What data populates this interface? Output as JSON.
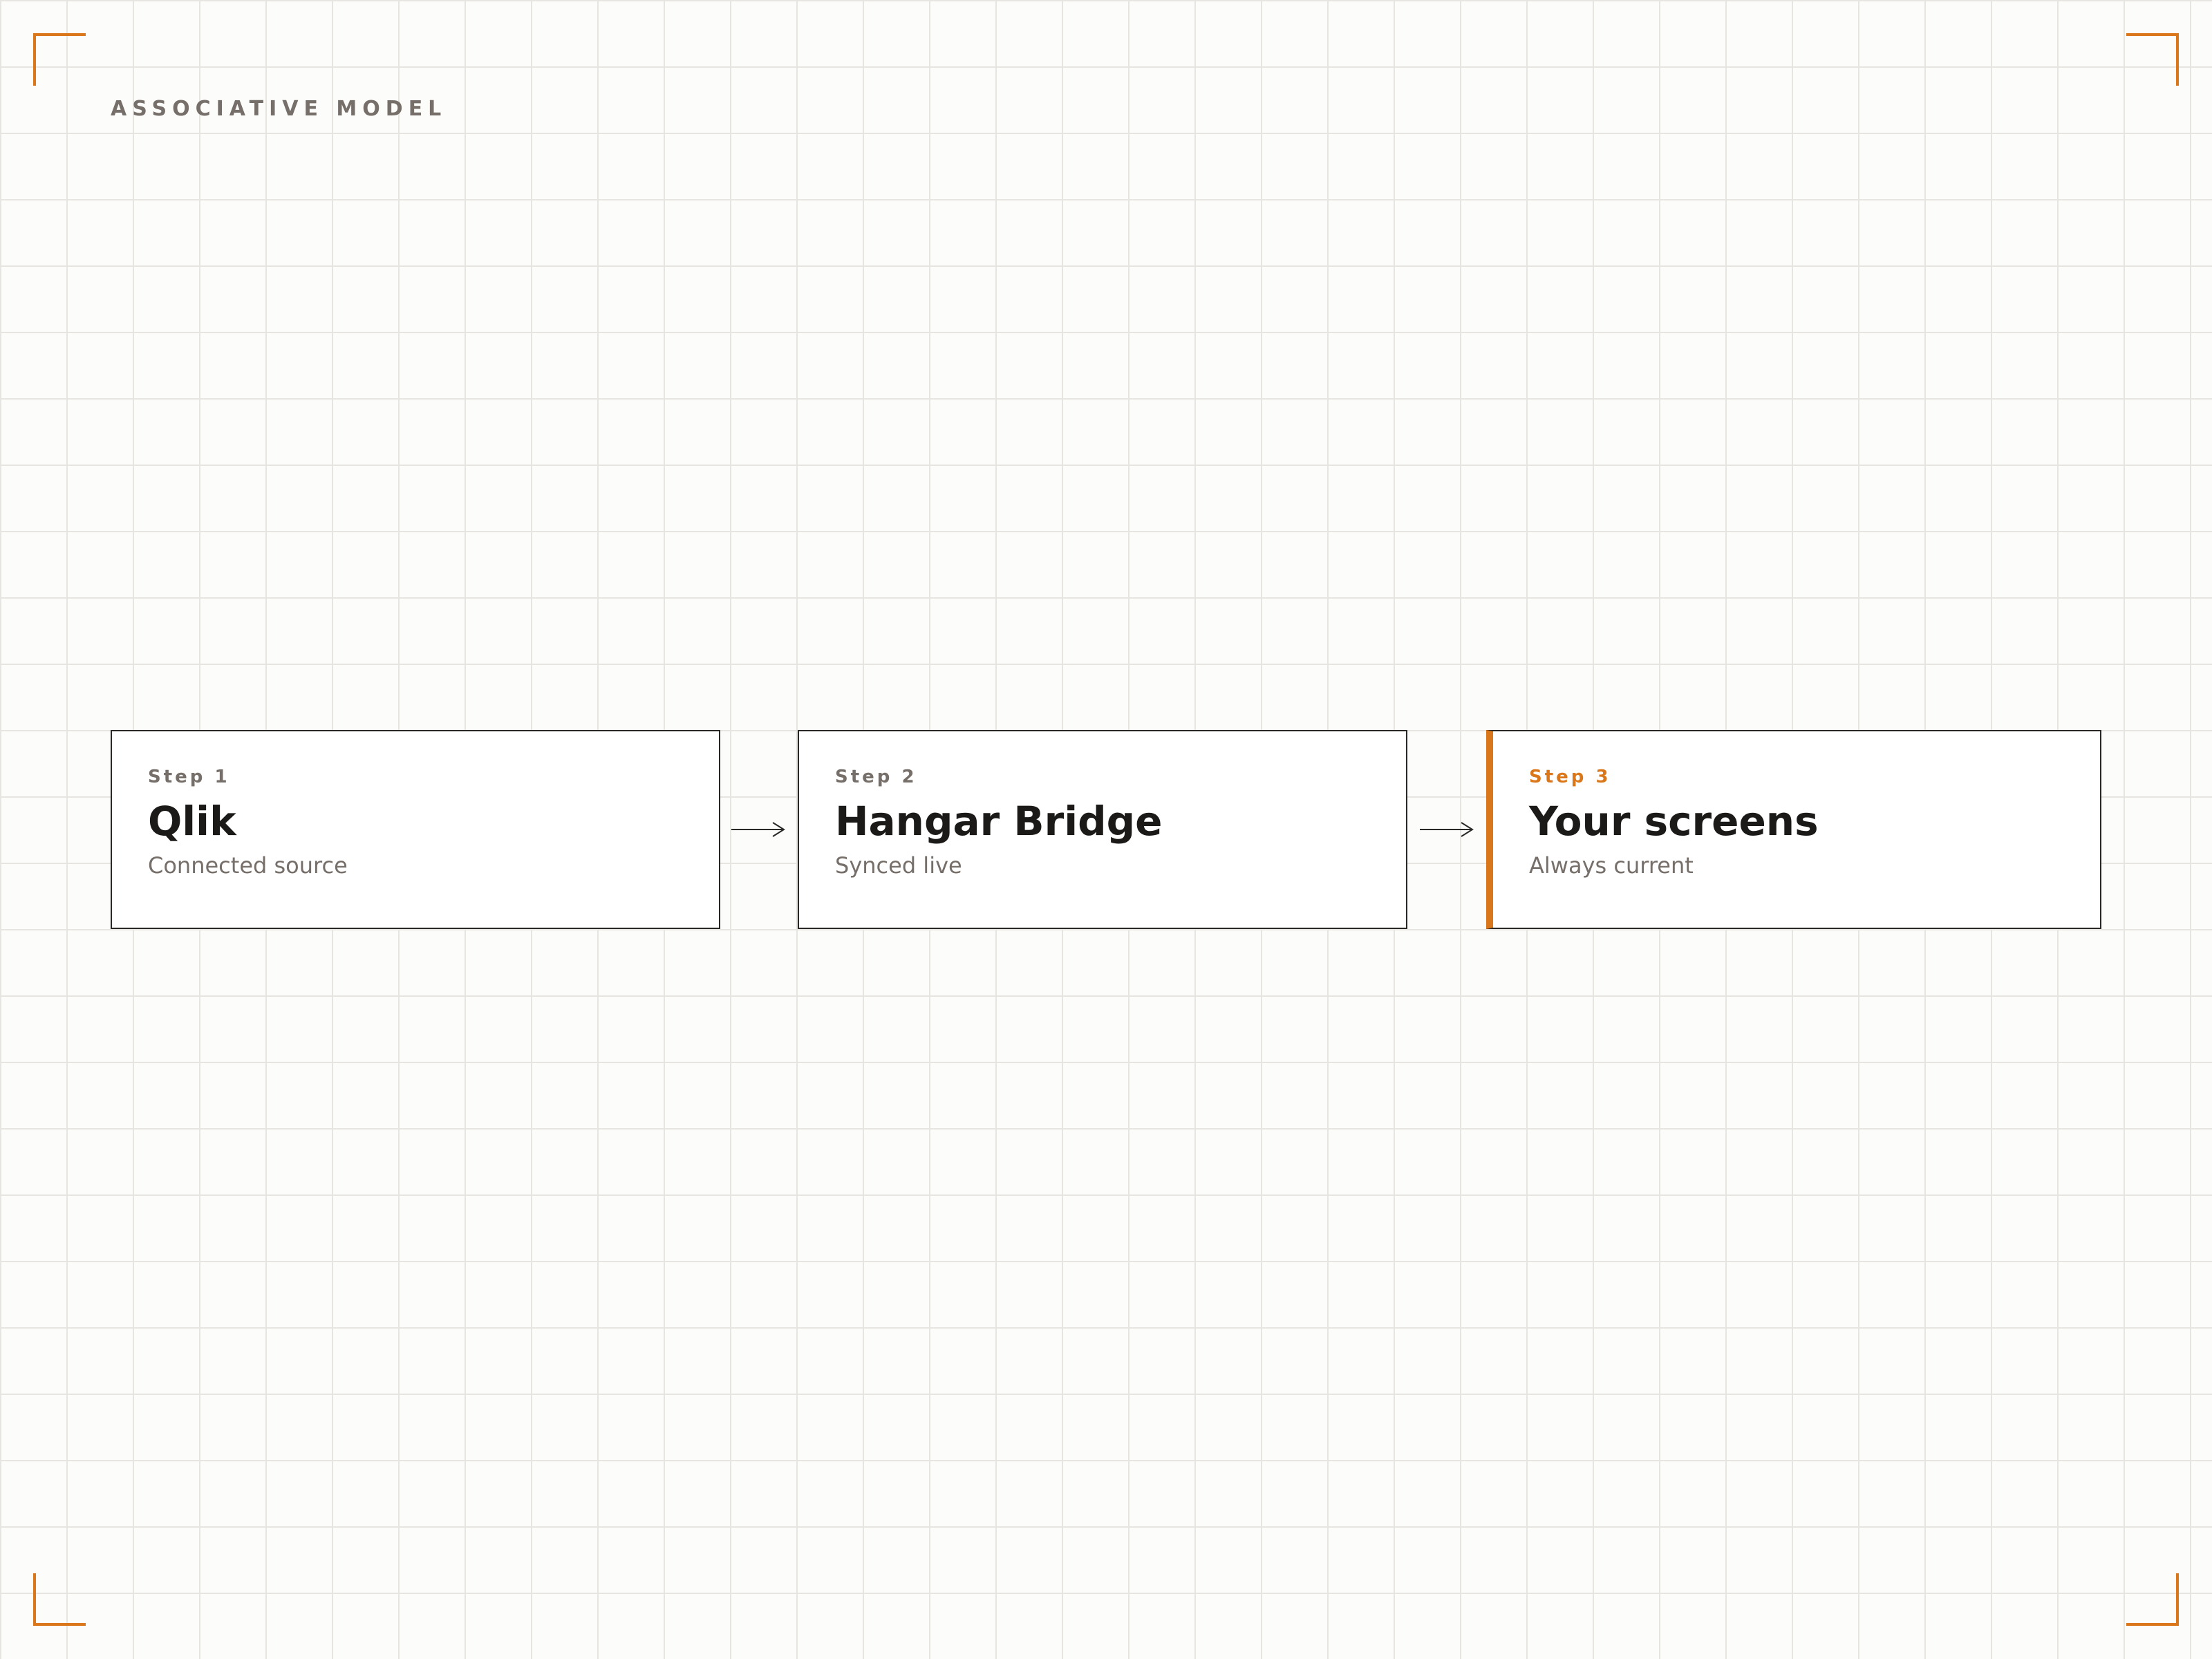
{
  "header": {
    "eyebrow": "ASSOCIATIVE MODEL"
  },
  "flow": {
    "accent_color": "#d9771a",
    "steps": [
      {
        "label": "Step 1",
        "title": "Qlik",
        "subtitle": "Connected source",
        "highlighted": false
      },
      {
        "label": "Step 2",
        "title": "Hangar Bridge",
        "subtitle": "Synced live",
        "highlighted": false
      },
      {
        "label": "Step 3",
        "title": "Your screens",
        "subtitle": "Always current",
        "highlighted": true
      }
    ],
    "connectors": [
      "arrow-right-icon",
      "arrow-right-icon"
    ]
  }
}
